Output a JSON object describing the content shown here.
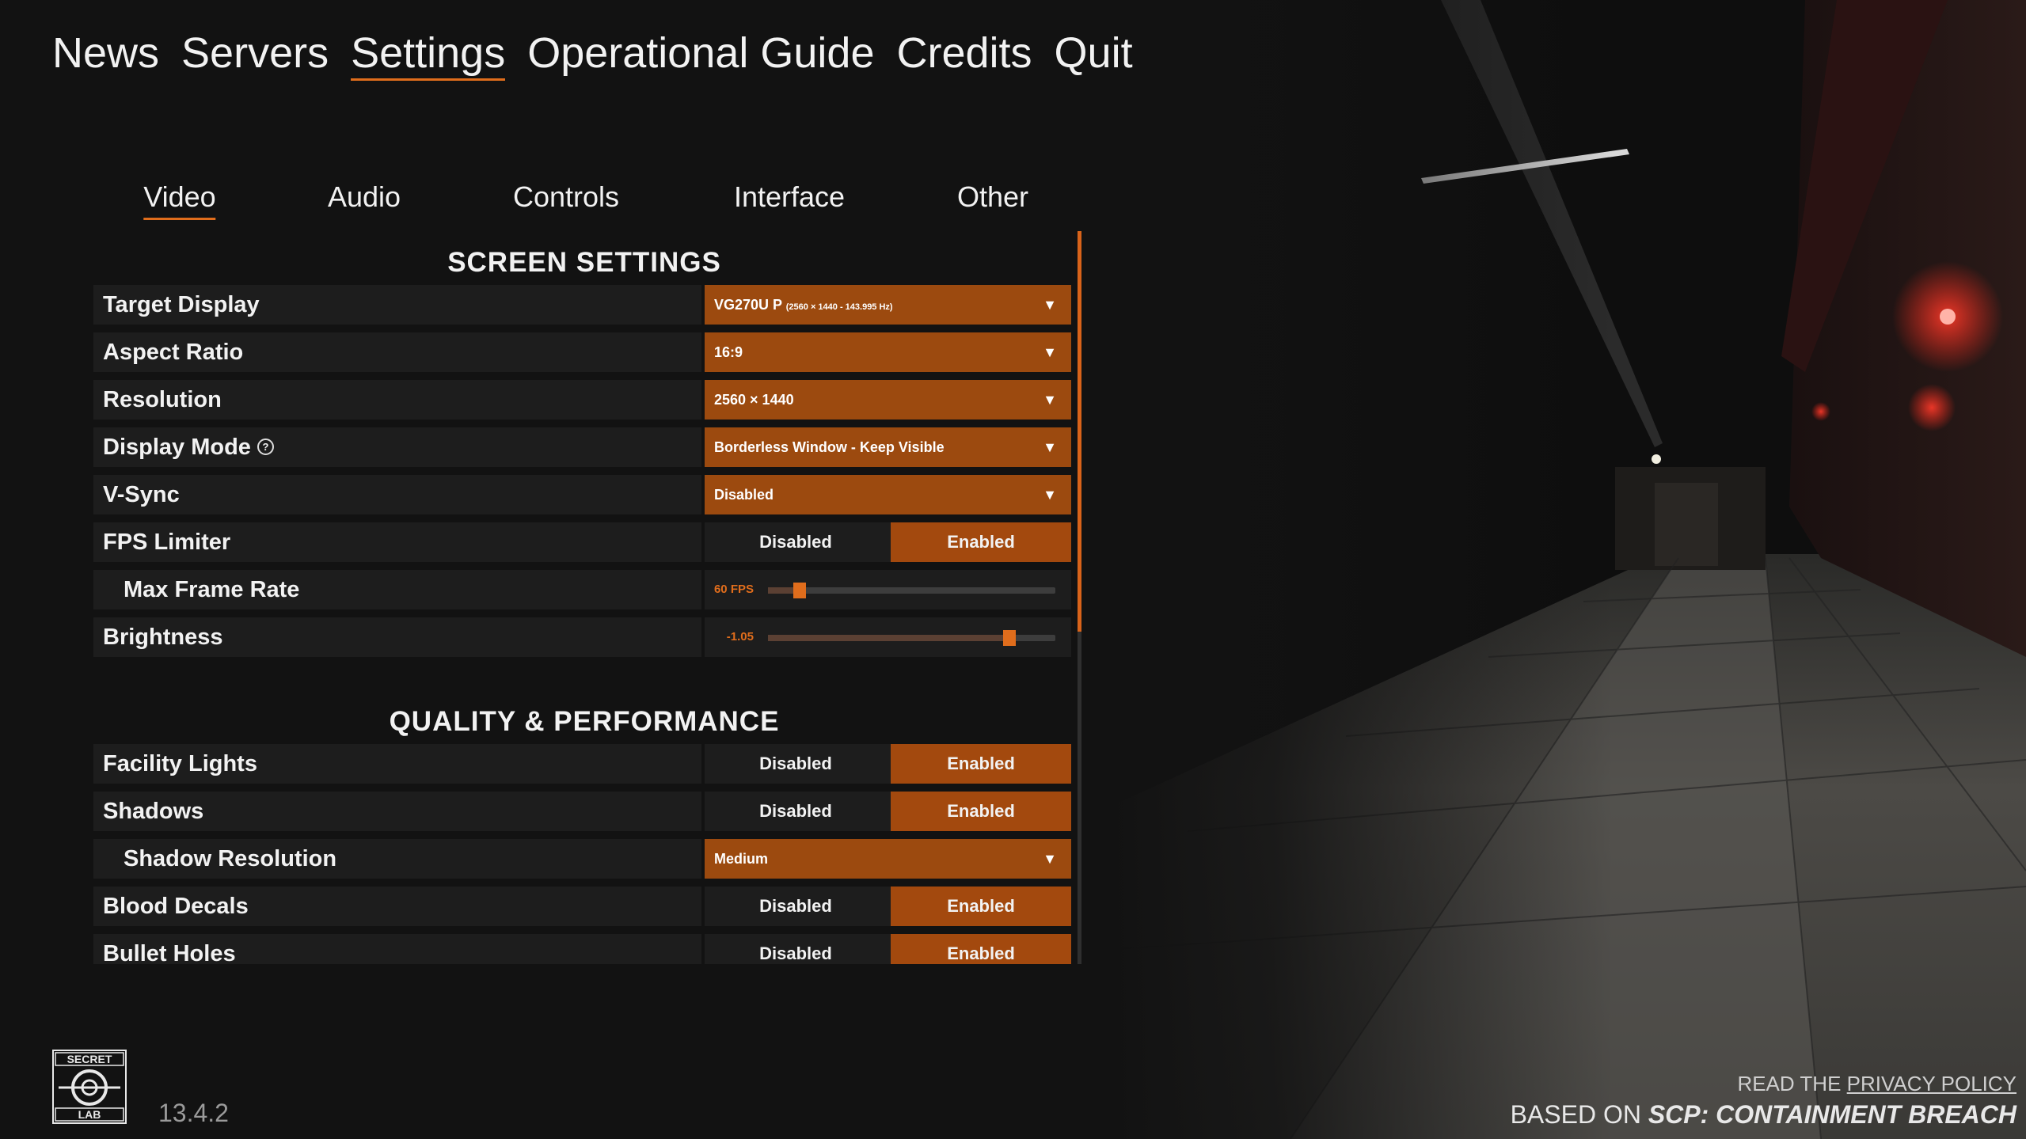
{
  "topnav": {
    "items": [
      "News",
      "Servers",
      "Settings",
      "Operational Guide",
      "Credits",
      "Quit"
    ],
    "active": "Settings"
  },
  "tabs": {
    "items": [
      "Video",
      "Audio",
      "Controls",
      "Interface",
      "Other"
    ],
    "active": "Video"
  },
  "sections": {
    "screen": "SCREEN SETTINGS",
    "quality": "QUALITY & PERFORMANCE"
  },
  "settings": {
    "target_display": {
      "label": "Target Display",
      "value": "VG270U P",
      "detail": "(2560 × 1440 - 143.995 Hz)"
    },
    "aspect_ratio": {
      "label": "Aspect Ratio",
      "value": "16:9"
    },
    "resolution": {
      "label": "Resolution",
      "value": "2560 × 1440"
    },
    "display_mode": {
      "label": "Display Mode",
      "value": "Borderless Window - Keep Visible"
    },
    "vsync": {
      "label": "V-Sync",
      "value": "Disabled"
    },
    "fps_limiter": {
      "label": "FPS Limiter",
      "off": "Disabled",
      "on": "Enabled",
      "selected": "Enabled"
    },
    "max_frame_rate": {
      "label": "Max Frame Rate",
      "value_text": "60 FPS",
      "level": 0.11
    },
    "brightness": {
      "label": "Brightness",
      "value_text": "-1.05",
      "level": 0.84
    },
    "facility_lights": {
      "label": "Facility Lights",
      "off": "Disabled",
      "on": "Enabled",
      "selected": "Enabled"
    },
    "shadows": {
      "label": "Shadows",
      "off": "Disabled",
      "on": "Enabled",
      "selected": "Enabled"
    },
    "shadow_resolution": {
      "label": "Shadow Resolution",
      "value": "Medium"
    },
    "blood_decals": {
      "label": "Blood Decals",
      "off": "Disabled",
      "on": "Enabled",
      "selected": "Enabled"
    },
    "bullet_holes": {
      "label": "Bullet Holes",
      "off": "Disabled",
      "on": "Enabled",
      "selected": "Enabled"
    }
  },
  "footer": {
    "logo_text_top": "SECRET",
    "logo_text_bottom": "LAB",
    "version": "13.4.2",
    "privacy_prefix": "READ THE ",
    "privacy_link": "PRIVACY POLICY",
    "based_prefix": "BASED ON ",
    "based_title": "SCP: CONTAINMENT BREACH"
  },
  "colors": {
    "accent": "#e06d1c",
    "dropdown_bg": "#9c4a0f",
    "toggle_on": "#a3490e",
    "row_bg": "#1d1d1d",
    "page_bg": "#121212"
  }
}
